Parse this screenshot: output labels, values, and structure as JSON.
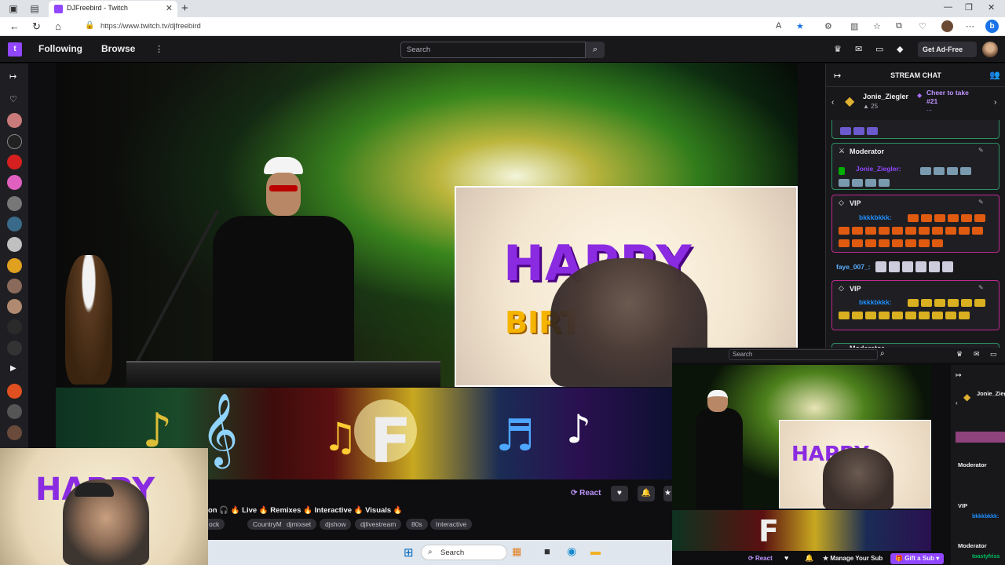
{
  "browser": {
    "tab_title": "DJFreebird - Twitch",
    "url": "https://www.twitch.tv/djfreebird"
  },
  "twitch_nav": {
    "following": "Following",
    "browse": "Browse",
    "search_placeholder": "Search",
    "get_ad_free": "Get Ad-Free"
  },
  "chat": {
    "header": "STREAM CHAT",
    "leaderboard_user": "Jonie_Ziegler",
    "leaderboard_count": "25",
    "cheer_text_1": "Cheer to take",
    "cheer_text_2": "#21",
    "cheer_ellipsis": "...",
    "messages": [
      {
        "badge": "Moderator",
        "user": "Jonie_Ziegler:",
        "user_color": "#9147ff"
      },
      {
        "badge": "VIP",
        "user": "bkkkbkkk:",
        "user_color": "#1e90ff"
      },
      {
        "badge": "",
        "user": "faye_007_:",
        "user_color": "#5ab0ff"
      },
      {
        "badge": "VIP",
        "user": "bkkkbkkk:",
        "user_color": "#1e90ff"
      },
      {
        "badge": "Moderator",
        "user": "",
        "user_color": "#9147ff"
      }
    ]
  },
  "stream": {
    "title_fragment": "on 🎧 🔥 Live 🔥 Remixes 🔥 Interactive 🔥 Visuals 🔥",
    "tags": [
      "ock",
      "CountryMusic",
      "djmixset",
      "djshow",
      "djlivestream",
      "80s",
      "Interactive"
    ],
    "react_label": "React"
  },
  "window2": {
    "search_placeholder": "Search",
    "chat_user": "Jonie_Ziegler",
    "moderator_1": "Moderator",
    "vip": "VIP",
    "moderator_2": "Moderator",
    "vip_user": "bkkkbkkk:",
    "mod_user": "toastyfriss",
    "react_label": "React",
    "manage_sub": "Manage Your Sub",
    "gift_sub": "Gift a Sub"
  },
  "taskbar": {
    "search_label": "Search"
  },
  "colors": {
    "twitch_purple": "#9146ff",
    "chat_border": "#2f8f64"
  }
}
